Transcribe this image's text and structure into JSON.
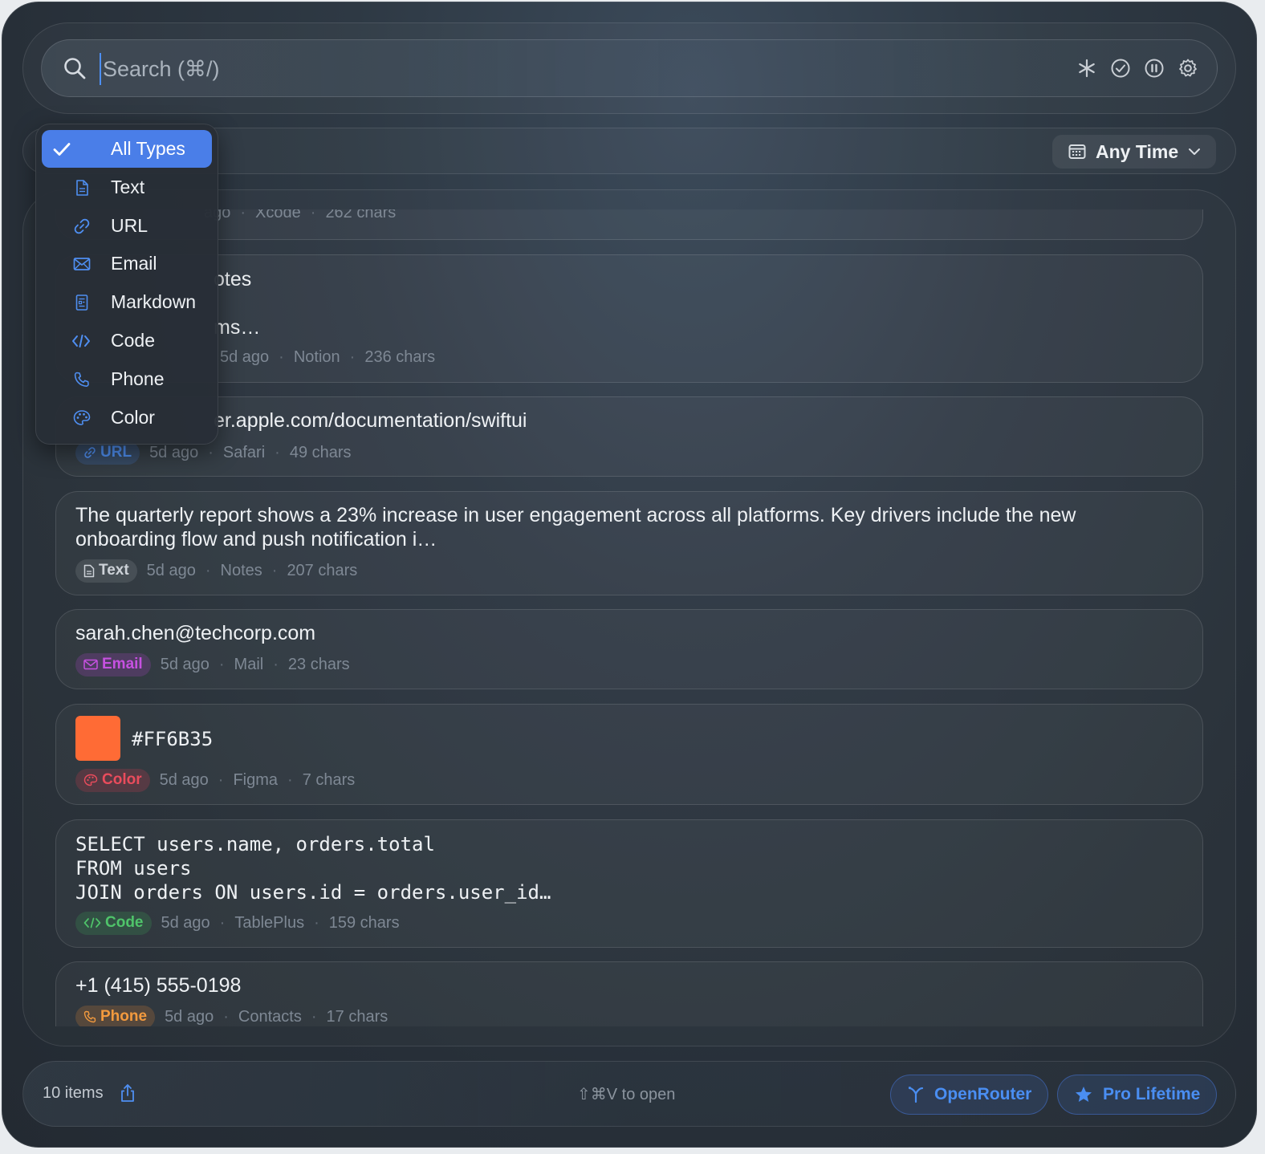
{
  "search": {
    "placeholder": "Search (⌘/)"
  },
  "toolbar": {
    "icons": [
      "asterisk-icon",
      "check-circle-icon",
      "pause-circle-icon",
      "gear-icon"
    ]
  },
  "time_filter": {
    "label": "Any Time"
  },
  "type_filter": {
    "selected": "All Types",
    "options": [
      {
        "label": "All Types",
        "icon": "checkmark-icon"
      },
      {
        "label": "Text",
        "icon": "document-icon"
      },
      {
        "label": "URL",
        "icon": "link-icon"
      },
      {
        "label": "Email",
        "icon": "envelope-icon"
      },
      {
        "label": "Markdown",
        "icon": "markdown-icon"
      },
      {
        "label": "Code",
        "icon": "code-icon"
      },
      {
        "label": "Phone",
        "icon": "phone-icon"
      },
      {
        "label": "Color",
        "icon": "palette-icon"
      }
    ]
  },
  "items": [
    {
      "partial_meta": "ago",
      "source": "Xcode",
      "size": "262 chars"
    },
    {
      "title_line1": "otes",
      "title_line2": "ms…",
      "age": "5d ago",
      "source": "Notion",
      "size": "236 chars"
    },
    {
      "title": "er.apple.com/documentation/swiftui",
      "badge": "URL",
      "age": "5d ago",
      "source": "Safari",
      "size": "49 chars"
    },
    {
      "title": "The quarterly report shows a 23% increase in user engagement across all platforms. Key drivers include the new onboarding flow and push notification i…",
      "badge": "Text",
      "age": "5d ago",
      "source": "Notes",
      "size": "207 chars"
    },
    {
      "title": "sarah.chen@techcorp.com",
      "badge": "Email",
      "age": "5d ago",
      "source": "Mail",
      "size": "23 chars"
    },
    {
      "title": "#FF6B35",
      "badge": "Color",
      "swatch": "#FF6B35",
      "age": "5d ago",
      "source": "Figma",
      "size": "7 chars"
    },
    {
      "code_lines": [
        "SELECT users.name, orders.total",
        "FROM users",
        "JOIN orders ON users.id = orders.user_id…"
      ],
      "badge": "Code",
      "age": "5d ago",
      "source": "TablePlus",
      "size": "159 chars"
    },
    {
      "title": "+1 (415) 555-0198",
      "badge": "Phone",
      "age": "5d ago",
      "source": "Contacts",
      "size": "17 chars"
    }
  ],
  "footer": {
    "count": "10 items",
    "hint": "⇧⌘V to open",
    "openrouter_label": "OpenRouter",
    "pro_label": "Pro Lifetime"
  },
  "colors": {
    "accent": "#4a7ee8",
    "swatch": "#FF6B35"
  }
}
